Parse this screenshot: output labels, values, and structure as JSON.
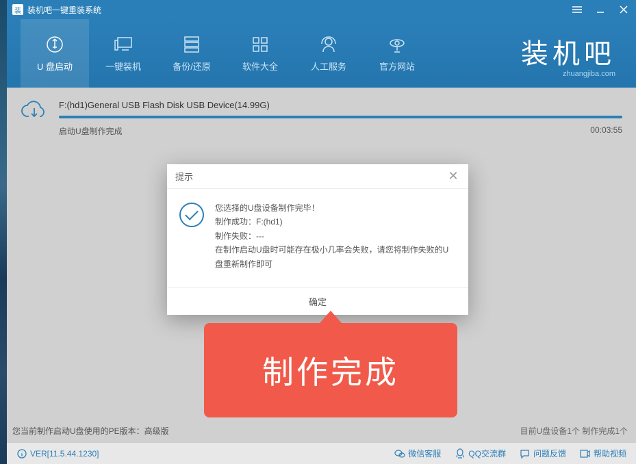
{
  "titlebar": {
    "title": "装机吧一键重装系统"
  },
  "nav": {
    "items": [
      {
        "label": "U 盘启动"
      },
      {
        "label": "一键装机"
      },
      {
        "label": "备份/还原"
      },
      {
        "label": "软件大全"
      },
      {
        "label": "人工服务"
      },
      {
        "label": "官方网站"
      }
    ]
  },
  "brand": {
    "text": "装机吧",
    "url": "zhuangjiba.com"
  },
  "progress": {
    "device": "F:(hd1)General USB Flash Disk USB Device(14.99G)",
    "status": "启动U盘制作完成",
    "time": "00:03:55"
  },
  "dialog": {
    "title": "提示",
    "line1": "您选择的U盘设备制作完毕！",
    "line2": "制作成功：F:(hd1)",
    "line3": "制作失败：---",
    "line4": "在制作启动U盘时可能存在极小几率会失败，请您将制作失败的U盘重新制作即可",
    "ok": "确定"
  },
  "callout": {
    "text": "制作完成"
  },
  "pe_info": "您当前制作启动U盘使用的PE版本：高级版",
  "usb_count": "目前U盘设备1个 制作完成1个",
  "footer": {
    "version": "VER[11.5.44.1230]",
    "links": {
      "wechat": "微信客服",
      "qq": "QQ交流群",
      "feedback": "问题反馈",
      "help": "帮助视频"
    }
  }
}
